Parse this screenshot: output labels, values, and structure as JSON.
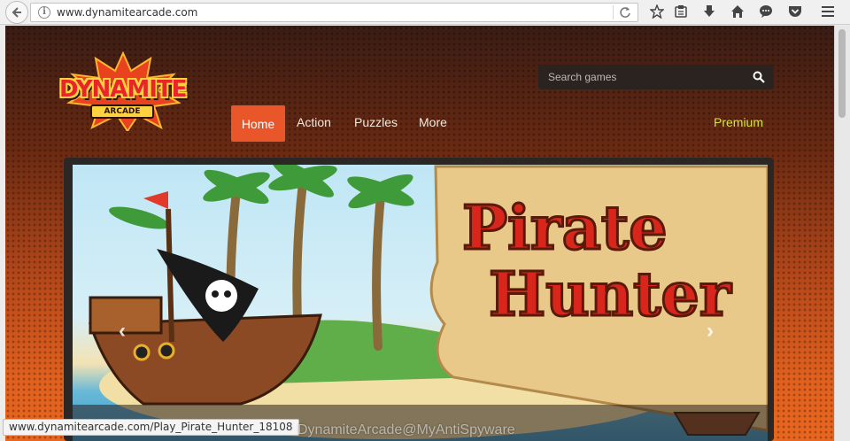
{
  "browser": {
    "url": "www.dynamitearcade.com",
    "status_url": "www.dynamitearcade.com/Play_Pirate_Hunter_18108",
    "icons": [
      "back-icon",
      "info-icon",
      "reload-icon",
      "star-icon",
      "clipboard-icon",
      "download-icon",
      "home-icon",
      "chat-icon",
      "pocket-icon",
      "menu-icon"
    ]
  },
  "site": {
    "logo": {
      "word": "DYNAMITE",
      "sub": "ARCADE"
    },
    "search": {
      "placeholder": "Search games"
    },
    "nav": {
      "home": "Home",
      "action": "Action",
      "puzzles": "Puzzles",
      "more": "More",
      "premium": "Premium"
    },
    "slider": {
      "title_line1": "Pirate",
      "title_line2": "Hunter"
    }
  },
  "watermark": "DynamiteArcade@MyAntiSpyware",
  "colors": {
    "accent": "#e8562a",
    "premium": "#d9e33b",
    "search_bg": "#2a2320"
  }
}
